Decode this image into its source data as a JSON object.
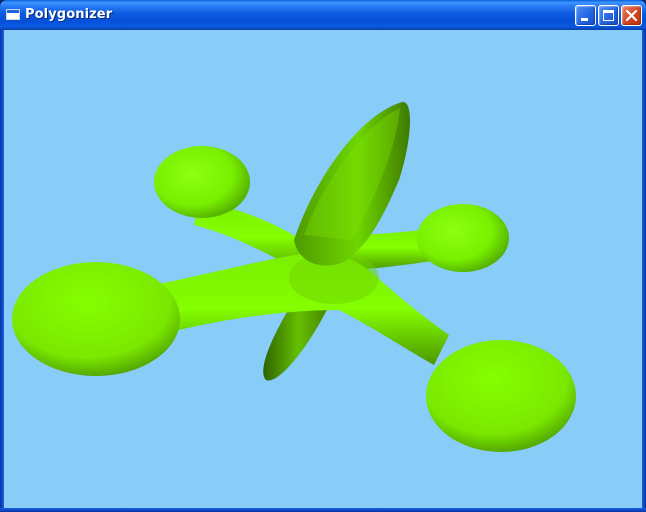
{
  "window": {
    "title": "Polygonizer",
    "icon": "app-window-icon",
    "controls": {
      "minimize_icon": "minimize-icon",
      "maximize_icon": "maximize-icon",
      "close_icon": "close-icon"
    }
  },
  "viewport": {
    "background_color": "#87cdf7",
    "shape_color": "#7fff00",
    "shape_shadow_color": "#3f7a00"
  }
}
